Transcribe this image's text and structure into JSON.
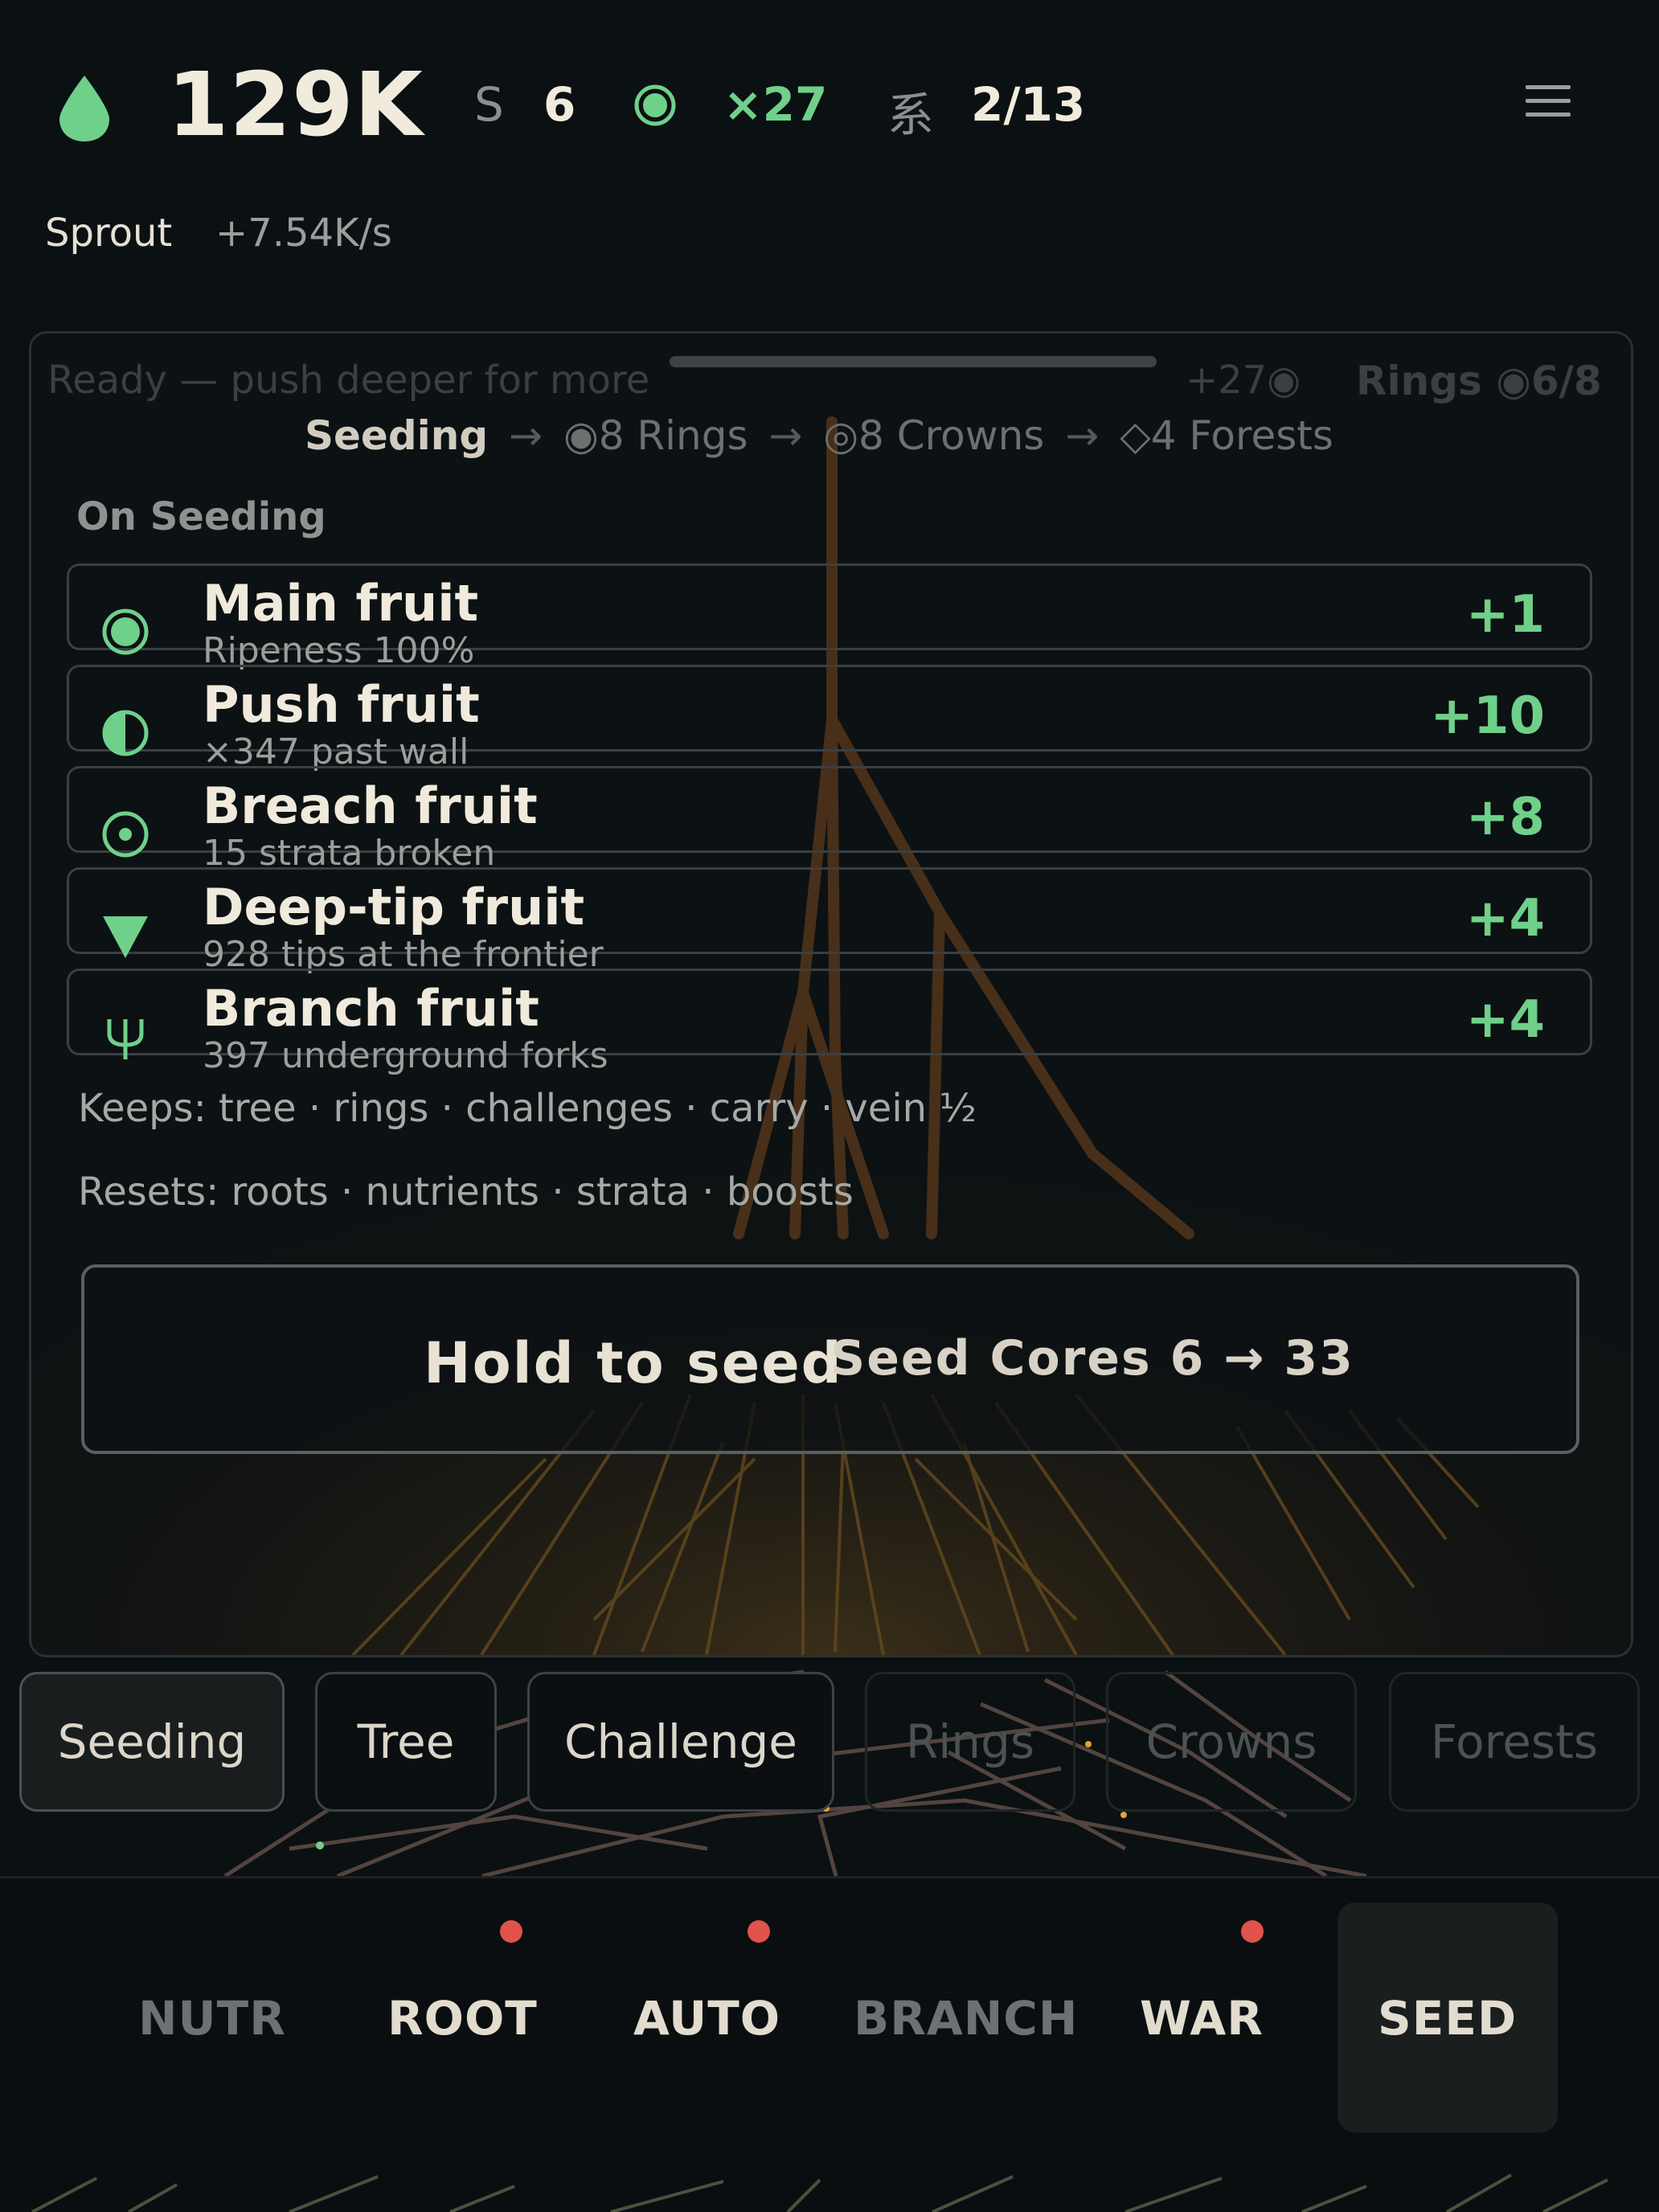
{
  "header": {
    "total": "129K",
    "seed_label": "S",
    "seed_value": "6",
    "multiplier": "×27",
    "system_glyph": "系",
    "system_value": "2/13",
    "stage": "Sprout",
    "rate": "+7.54K/s"
  },
  "panel": {
    "ready_text": "Ready — push deeper for more",
    "ready_gain": "+27◉",
    "ready_rings": "Rings ◉6/8",
    "path": {
      "current": "Seeding",
      "step1": "◉8 Rings",
      "step2": "◎8 Crowns",
      "step3": "◇4 Forests",
      "arrow": "→"
    },
    "on_seeding_label": "On Seeding",
    "fruits": [
      {
        "name": "Main fruit",
        "sub": "Ripeness 100%",
        "value": "+1",
        "icon": "full-circle-icon"
      },
      {
        "name": "Push fruit",
        "sub": "×347 past wall",
        "value": "+10",
        "icon": "half-circle-icon"
      },
      {
        "name": "Breach fruit",
        "sub": "15 strata broken",
        "value": "+8",
        "icon": "target-icon"
      },
      {
        "name": "Deep-tip fruit",
        "sub": "928 tips at the frontier",
        "value": "+4",
        "icon": "triangle-down-icon"
      },
      {
        "name": "Branch fruit",
        "sub": "397 underground forks",
        "value": "+4",
        "icon": "psi-icon"
      }
    ],
    "keeps": "Keeps: tree · rings · challenges · carry · vein ½",
    "resets": "Resets: roots · nutrients · strata · boosts",
    "hold_label": "Hold to seed",
    "hold_cores": "Seed Cores 6 → 33"
  },
  "subtabs": [
    "Seeding",
    "Tree",
    "Challenge",
    "Rings",
    "Crowns",
    "Forests"
  ],
  "nav": [
    "NUTR",
    "ROOT",
    "AUTO",
    "BRANCH",
    "WAR",
    "SEED"
  ],
  "colors": {
    "accent_green": "#6fd08a",
    "root_orange": "#e89a2c",
    "alert_red": "#e0534a",
    "background": "#0b1012"
  }
}
